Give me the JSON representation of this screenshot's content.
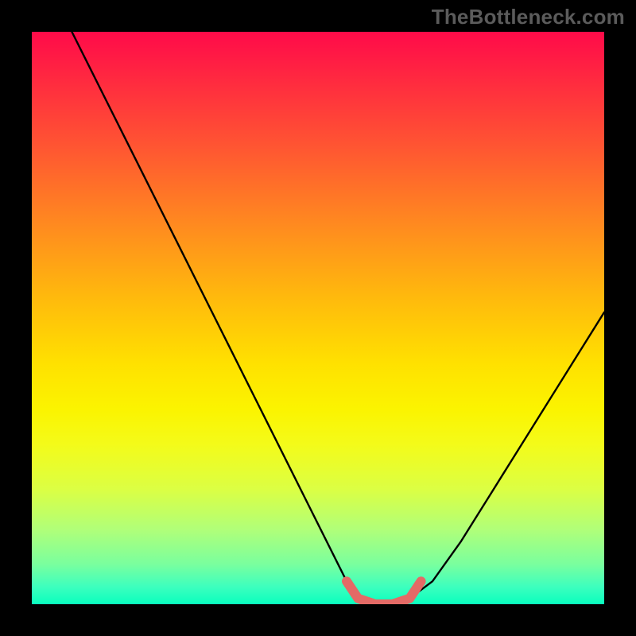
{
  "watermark": "TheBottleneck.com",
  "chart_data": {
    "type": "line",
    "title": "",
    "xlabel": "",
    "ylabel": "",
    "xlim": [
      0,
      100
    ],
    "ylim": [
      0,
      100
    ],
    "series": [
      {
        "name": "bottleneck-curve",
        "x": [
          7,
          10,
          15,
          20,
          25,
          30,
          35,
          40,
          45,
          50,
          55,
          57,
          60,
          63,
          66,
          70,
          75,
          80,
          85,
          90,
          95,
          100
        ],
        "y": [
          100,
          94,
          84,
          74,
          64,
          54,
          44,
          34,
          24,
          14,
          4,
          1,
          0,
          0,
          1,
          4,
          11,
          19,
          27,
          35,
          43,
          51
        ]
      }
    ],
    "highlight_band": {
      "name": "optimal-region",
      "color": "#e46a66",
      "x": [
        55,
        57,
        60,
        63,
        66,
        68
      ],
      "y": [
        4,
        1,
        0,
        0,
        1,
        4
      ]
    },
    "background_gradient": {
      "top": "#ff0b49",
      "mid": "#ffe100",
      "bottom": "#09ffbe"
    }
  }
}
